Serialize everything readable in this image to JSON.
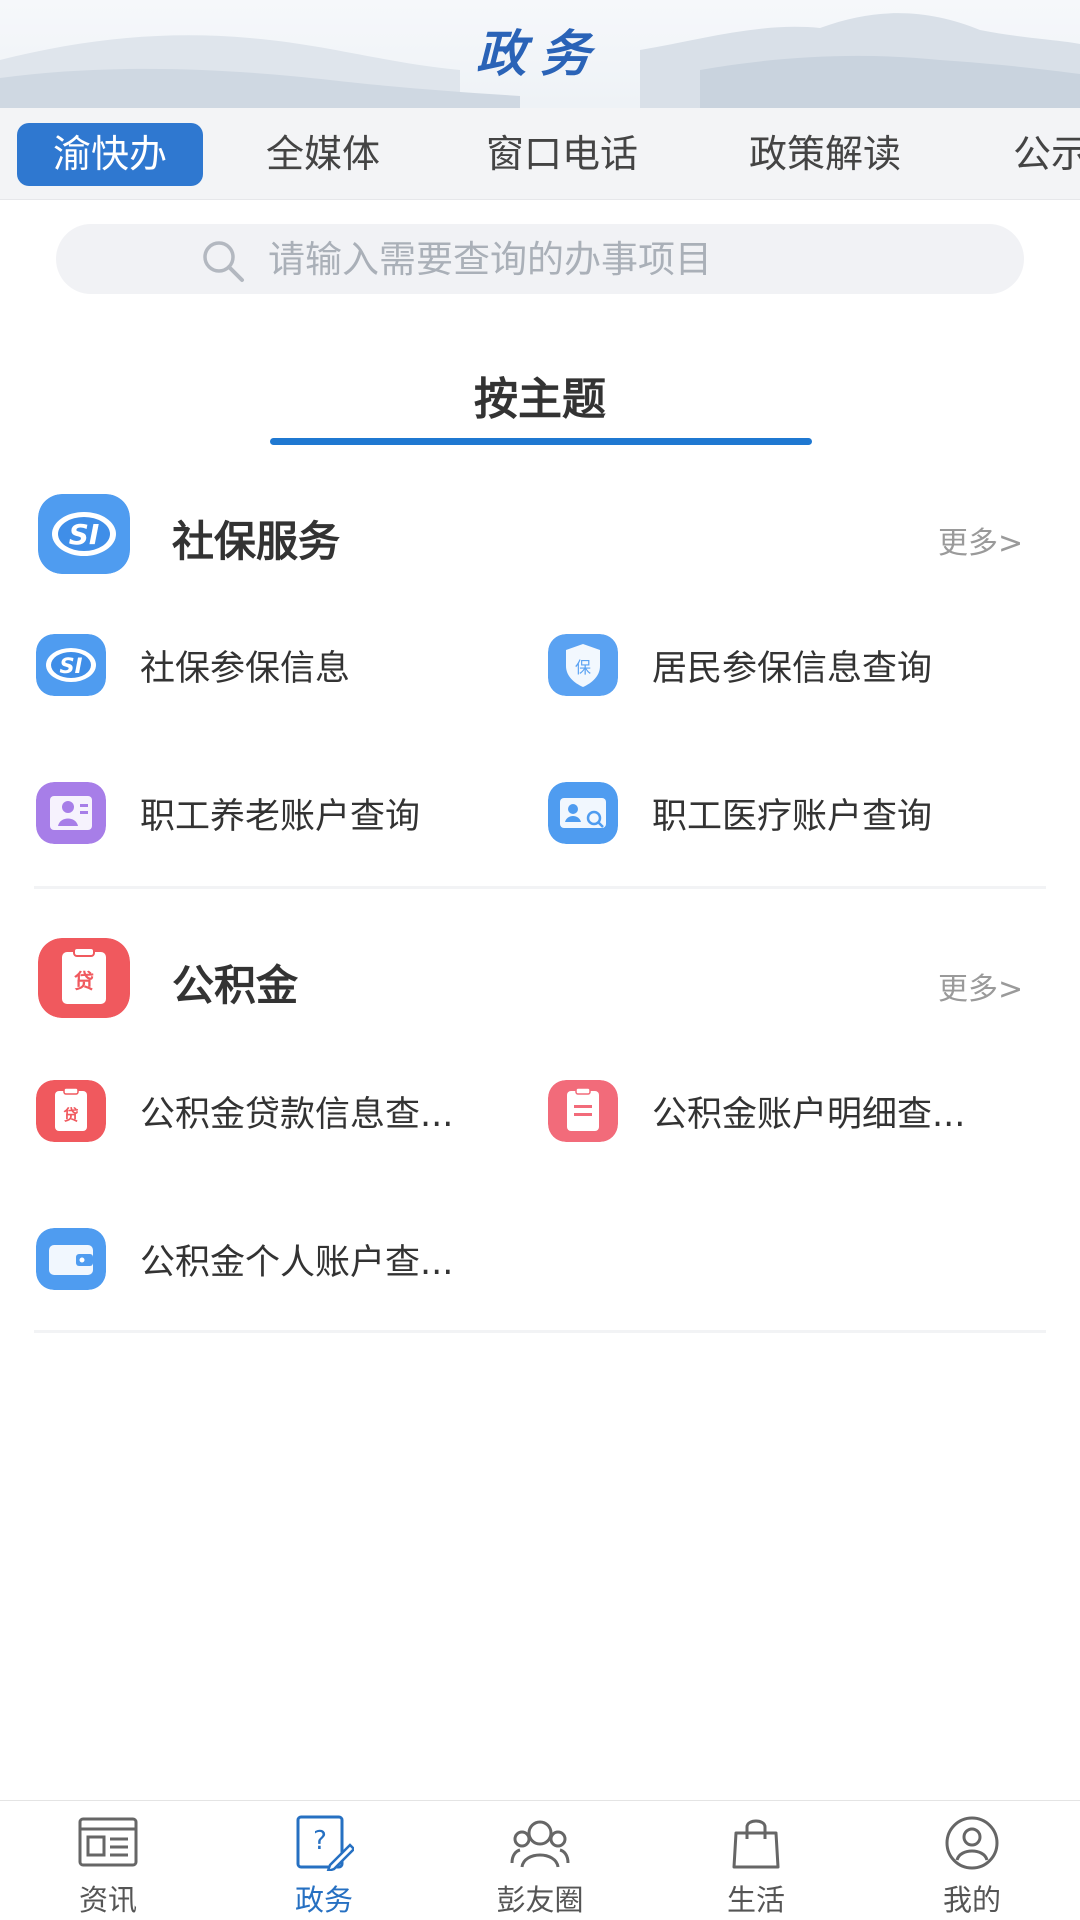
{
  "header": {
    "title": "政务"
  },
  "tabs": [
    {
      "label": "渝快办",
      "active": true
    },
    {
      "label": "全媒体",
      "active": false
    },
    {
      "label": "窗口电话",
      "active": false
    },
    {
      "label": "政策解读",
      "active": false
    },
    {
      "label": "公示",
      "active": false
    }
  ],
  "search": {
    "placeholder": "请输入需要查询的办事项目"
  },
  "topic_tab": {
    "label": "按主题"
  },
  "categories": [
    {
      "title": "社保服务",
      "more": "更多>",
      "icon": "social-security-icon",
      "items": [
        {
          "label": "社保参保信息",
          "icon": "social-security-icon"
        },
        {
          "label": "居民参保信息查询",
          "icon": "insurance-shield-icon"
        },
        {
          "label": "职工养老账户查询",
          "icon": "elderly-account-icon"
        },
        {
          "label": "职工医疗账户查询",
          "icon": "medical-card-icon"
        }
      ]
    },
    {
      "title": "公积金",
      "more": "更多>",
      "icon": "loan-clipboard-icon",
      "items": [
        {
          "label": "公积金贷款信息查...",
          "icon": "loan-clipboard-icon"
        },
        {
          "label": "公积金账户明细查...",
          "icon": "account-detail-icon"
        },
        {
          "label": "公积金个人账户查...",
          "icon": "wallet-icon"
        }
      ]
    }
  ],
  "bottom_nav": [
    {
      "label": "资讯",
      "icon": "news-icon",
      "active": false
    },
    {
      "label": "政务",
      "icon": "government-affairs-icon",
      "active": true
    },
    {
      "label": "彭友圈",
      "icon": "friends-circle-icon",
      "active": false
    },
    {
      "label": "生活",
      "icon": "shopping-bag-icon",
      "active": false
    },
    {
      "label": "我的",
      "icon": "profile-icon",
      "active": false
    }
  ],
  "colors": {
    "accent": "#2f78d0",
    "title_blue": "#2a63b7",
    "underline": "#1f78d1",
    "nav_active": "#2670c2"
  }
}
